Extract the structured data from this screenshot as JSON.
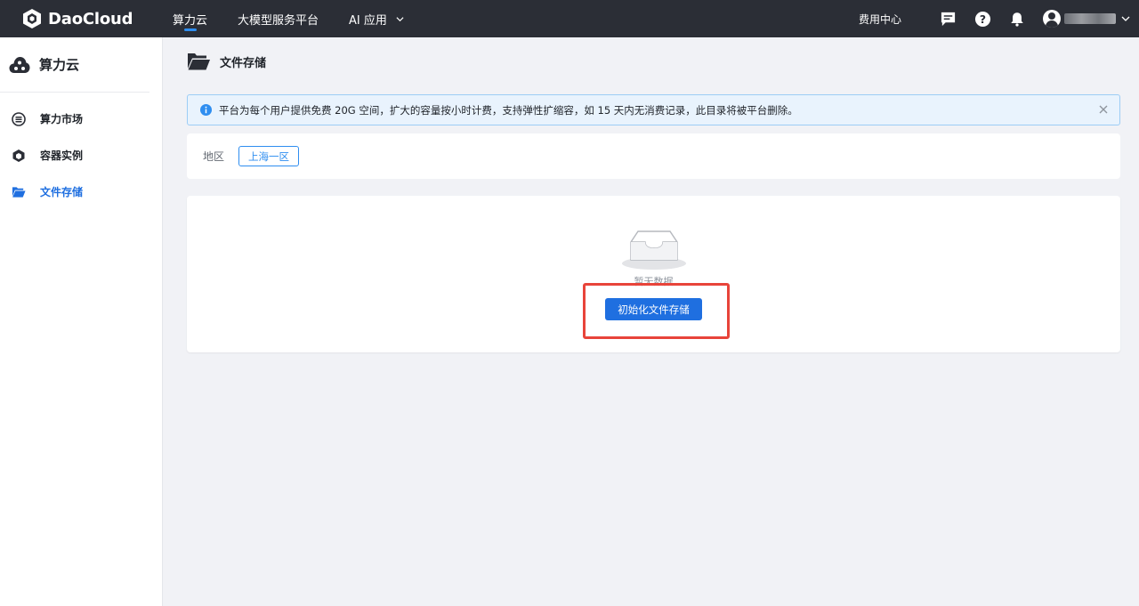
{
  "header": {
    "logo_text": "DaoCloud",
    "nav": [
      {
        "label": "算力云",
        "active": true
      },
      {
        "label": "大模型服务平台",
        "active": false
      },
      {
        "label": "AI 应用",
        "active": false,
        "dropdown": true
      }
    ],
    "billing_label": "费用中心",
    "icons": [
      "message-icon",
      "help-icon",
      "bell-icon",
      "user-avatar-icon"
    ]
  },
  "sidebar": {
    "title": "算力云",
    "items": [
      {
        "label": "算力市场",
        "icon": "market-icon",
        "active": false
      },
      {
        "label": "容器实例",
        "icon": "container-icon",
        "active": false
      },
      {
        "label": "文件存储",
        "icon": "folder-icon",
        "active": true
      }
    ]
  },
  "main": {
    "title": "文件存储",
    "alert_text": "平台为每个用户提供免费 20G 空间，扩大的容量按小时计费，支持弹性扩缩容，如 15 天内无消费记录，此目录将被平台删除。",
    "region_label": "地区",
    "region_value": "上海一区",
    "empty_text": "暂无数据",
    "init_button": "初始化文件存储"
  },
  "colors": {
    "topbar": "#2b2e36",
    "accent": "#1f6fe0",
    "highlight": "#e8443a",
    "alert_bg": "#e9f3fd"
  }
}
